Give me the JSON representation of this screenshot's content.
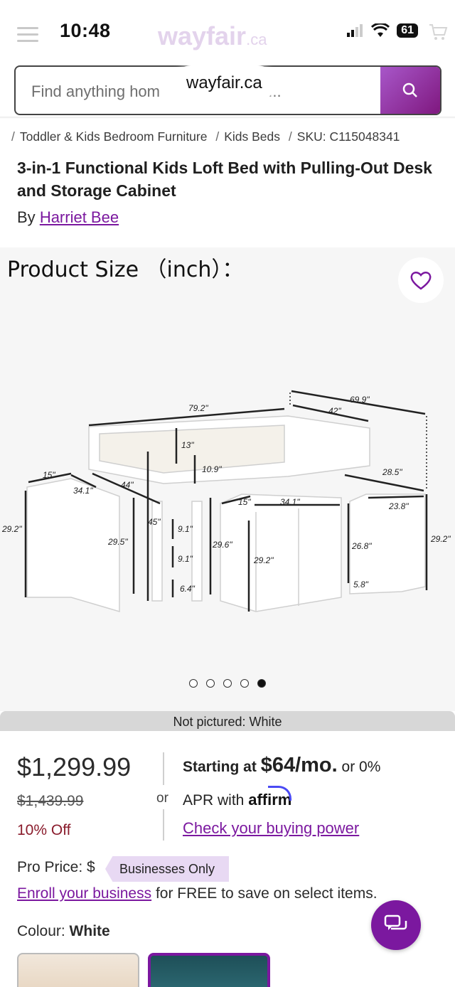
{
  "status_bar": {
    "time": "10:48",
    "battery": "61"
  },
  "header": {
    "brand": "wayfair",
    "brand_suffix": ".ca",
    "url": "wayfair.ca",
    "search_placeholder": "Find anything hom",
    "search_placeholder_tail": "a..."
  },
  "breadcrumb": [
    "Toddler & Kids Bedroom Furniture",
    "Kids Beds",
    "SKU: C115048341"
  ],
  "product": {
    "title": "3-in-1 Functional Kids Loft Bed with Pulling-Out Desk and Storage Cabinet",
    "by_label": "By",
    "brand": "Harriet Bee"
  },
  "gallery": {
    "caption": "Product Size （inch）：",
    "not_pictured": "Not pictured: White",
    "dot_count": 5,
    "active_dot": 4,
    "dimensions": [
      "79.2\"",
      "69.9\"",
      "42\"",
      "13\"",
      "10.9\"",
      "15\"",
      "34.1\"",
      "44\"",
      "45\"",
      "29.2\"",
      "29.5\"",
      "9.1\"",
      "9.1\"",
      "6.4\"",
      "29.6\"",
      "15\"",
      "34.1\"",
      "29.2\"",
      "28.5\"",
      "23.8\"",
      "26.8\"",
      "29.2\"",
      "5.8\""
    ]
  },
  "pricing": {
    "price": "$1,299.99",
    "was": "$1,439.99",
    "discount": "10% Off",
    "or": "or",
    "starting_at": "Starting at",
    "monthly": "$64/mo.",
    "or_zero": "or 0%",
    "apr_with": "APR with",
    "affirm": "affirm",
    "buying_power": "Check your buying power"
  },
  "pro": {
    "label": "Pro Price:",
    "dollar": "$",
    "tag": "Businesses Only",
    "enroll_link": "Enroll your business",
    "enroll_text": "for FREE to save on select items."
  },
  "colour": {
    "label": "Colour:",
    "value": "White"
  },
  "colors": {
    "accent": "#7b189f",
    "discount": "#8a1c2c"
  }
}
